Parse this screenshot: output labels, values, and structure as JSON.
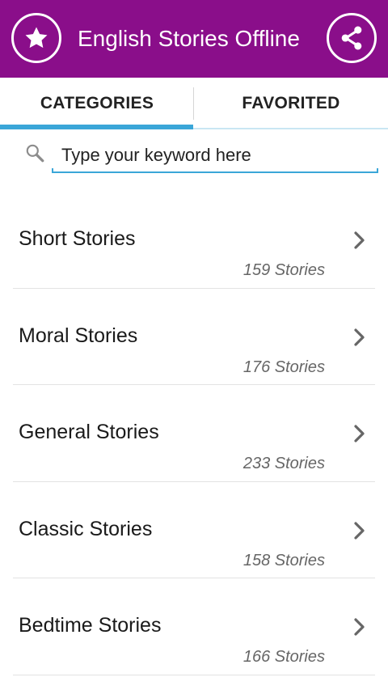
{
  "appbar": {
    "title": "English Stories Offline",
    "left_icon": "star-icon",
    "right_icon": "share-icon",
    "color": "#8a0e8a"
  },
  "tabs": [
    {
      "label": "CATEGORIES",
      "selected": true
    },
    {
      "label": "FAVORITED",
      "selected": false
    }
  ],
  "search": {
    "placeholder": "Type your keyword here",
    "value": ""
  },
  "categories": [
    {
      "title": "Short Stories",
      "count": "159 Stories"
    },
    {
      "title": "Moral Stories",
      "count": "176 Stories"
    },
    {
      "title": "General Stories",
      "count": "233 Stories"
    },
    {
      "title": "Classic Stories",
      "count": "158 Stories"
    },
    {
      "title": "Bedtime Stories",
      "count": "166 Stories"
    }
  ],
  "accent_color": "#3aa6d8"
}
